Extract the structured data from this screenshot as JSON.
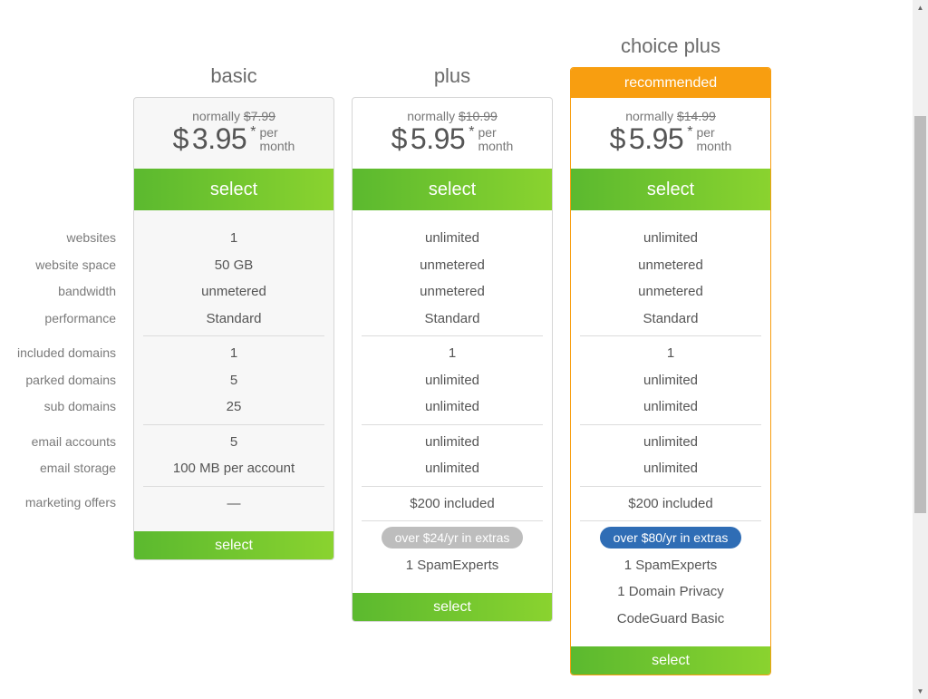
{
  "labels": [
    "websites",
    "website space",
    "bandwidth",
    "performance",
    "included domains",
    "parked domains",
    "sub domains",
    "email accounts",
    "email storage",
    "marketing offers"
  ],
  "plans": [
    {
      "title": "basic",
      "normally_label": "normally",
      "old_price": "$7.99",
      "currency": "$",
      "price": "3.95",
      "asterisk": "*",
      "per": "per",
      "month": "month",
      "select_label": "select",
      "features": [
        "1",
        "50 GB",
        "unmetered",
        "Standard",
        "1",
        "5",
        "25",
        "5",
        "100 MB per account",
        "—"
      ]
    },
    {
      "title": "plus",
      "normally_label": "normally",
      "old_price": "$10.99",
      "currency": "$",
      "price": "5.95",
      "asterisk": "*",
      "per": "per",
      "month": "month",
      "select_label": "select",
      "features": [
        "unlimited",
        "unmetered",
        "unmetered",
        "Standard",
        "1",
        "unlimited",
        "unlimited",
        "unlimited",
        "unlimited",
        "$200 included"
      ],
      "extras_badge": "over $24/yr in extras",
      "extras": [
        "1 SpamExperts"
      ]
    },
    {
      "title": "choice plus",
      "recommended": "recommended",
      "normally_label": "normally",
      "old_price": "$14.99",
      "currency": "$",
      "price": "5.95",
      "asterisk": "*",
      "per": "per",
      "month": "month",
      "select_label": "select",
      "features": [
        "unlimited",
        "unmetered",
        "unmetered",
        "Standard",
        "1",
        "unlimited",
        "unlimited",
        "unlimited",
        "unlimited",
        "$200 included"
      ],
      "extras_badge": "over $80/yr in extras",
      "extras": [
        "1 SpamExperts",
        "1 Domain Privacy",
        "CodeGuard Basic"
      ]
    }
  ],
  "colors": {
    "green_start": "#5bb92f",
    "green_end": "#8ad32f",
    "recommended_orange": "#f89e10",
    "badge_gray": "#bdbdbd",
    "badge_blue": "#2f6db5"
  },
  "scrollbar": {
    "up_icon": "▲",
    "down_icon": "▼"
  }
}
